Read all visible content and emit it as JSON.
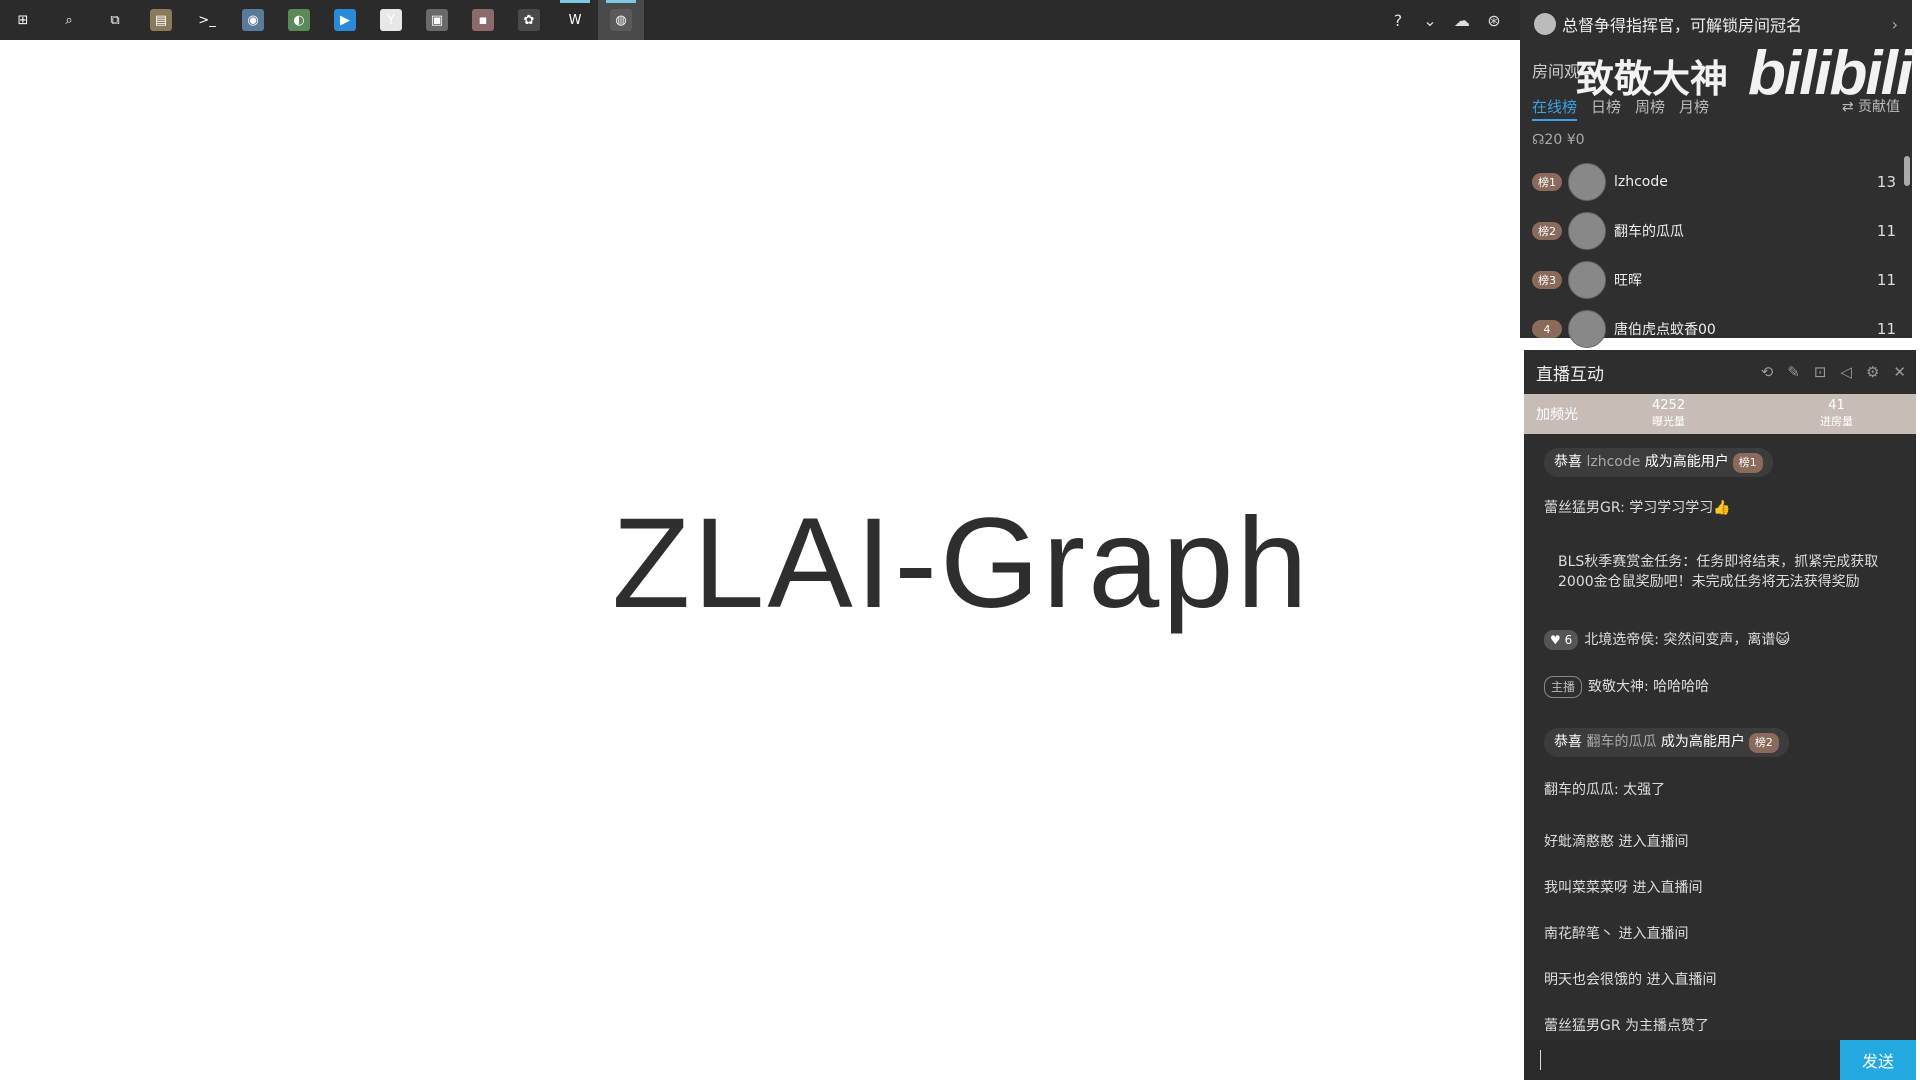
{
  "taskbar": {
    "icons": [
      {
        "name": "windows-start-icon",
        "glyph": "⊞",
        "color": "#2b2b2b"
      },
      {
        "name": "search-icon",
        "glyph": "⌕",
        "color": "#2b2b2b"
      },
      {
        "name": "task-view-icon",
        "glyph": "⧉",
        "color": "#2b2b2b"
      },
      {
        "name": "file-explorer-icon",
        "glyph": "▤",
        "color": "#8a7a5a"
      },
      {
        "name": "terminal-icon",
        "glyph": ">_",
        "color": "#2b2b2b"
      },
      {
        "name": "chrome-icon",
        "glyph": "◉",
        "color": "#5a7a9a"
      },
      {
        "name": "wechat-icon",
        "glyph": "◐",
        "color": "#5a8a5a"
      },
      {
        "name": "blue-app-icon",
        "glyph": "▶",
        "color": "#2a8ad8"
      },
      {
        "name": "white-app-icon",
        "glyph": "Y",
        "color": "#e8e8e8"
      },
      {
        "name": "editor-icon",
        "glyph": "▣",
        "color": "#6a6a6a"
      },
      {
        "name": "brown-app-icon",
        "glyph": "▪",
        "color": "#8a6a6a"
      },
      {
        "name": "game-app-icon",
        "glyph": "✿",
        "color": "#4a4a4a"
      },
      {
        "name": "wps-icon",
        "glyph": "W",
        "color": "#2b2b2b"
      },
      {
        "name": "live-app-icon",
        "glyph": "◍",
        "color": "#5a5a5a"
      }
    ],
    "tray": [
      {
        "name": "help-icon",
        "glyph": "?"
      },
      {
        "name": "chevron-down-icon",
        "glyph": "⌄"
      },
      {
        "name": "cloud-icon",
        "glyph": "☁"
      },
      {
        "name": "network-icon",
        "glyph": "⊛"
      }
    ]
  },
  "main": {
    "title": "ZLAI-Graph"
  },
  "rank_panel": {
    "banner": "总督争得指挥官，可解锁房间冠名",
    "banner_arrow": "›",
    "room_label": "房间观",
    "watermark": "致敬大神",
    "logo": "bilibili",
    "tabs": [
      "在线榜",
      "日榜",
      "周榜",
      "月榜"
    ],
    "active_tab": 0,
    "contribution_label": "⇄ 贡献值",
    "counts": "☊20  ¥0",
    "rows": [
      {
        "badge": "榜1",
        "name": "lzhcode",
        "score": "13"
      },
      {
        "badge": "榜2",
        "name": "翻车的瓜瓜",
        "score": "11"
      },
      {
        "badge": "榜3",
        "name": "旺晖",
        "score": "11"
      },
      {
        "badge": "4",
        "name": "唐伯虎点蚊香00",
        "score": "11"
      }
    ]
  },
  "chat_panel": {
    "title": "直播互动",
    "stats_label": "加频光",
    "stats": [
      {
        "value": "4252",
        "label": "曝光量"
      },
      {
        "value": "41",
        "label": "进房量"
      }
    ],
    "messages": [
      {
        "type": "pill",
        "prefix": "恭喜",
        "user": "lzhcode",
        "suffix": "成为高能用户",
        "badge": "榜1"
      },
      {
        "type": "plain",
        "text": "蕾丝猛男GR: 学习学习学习👍"
      },
      {
        "type": "plain",
        "text": "BLS秋季赛赏金任务：任务即将结束，抓紧完成获取2000金仓鼠奖励吧！未完成任务将无法获得奖励"
      },
      {
        "type": "fan",
        "tag": "♥ 6",
        "text": "北境选帝侯: 突然间变声，离谱😺"
      },
      {
        "type": "host",
        "tag": "主播",
        "text": "致敬大神: 哈哈哈哈"
      },
      {
        "type": "pill",
        "prefix": "恭喜",
        "user": "翻车的瓜瓜",
        "suffix": "成为高能用户",
        "badge": "榜2"
      },
      {
        "type": "plain",
        "text": "翻车的瓜瓜: 太强了"
      },
      {
        "type": "plain",
        "text": "好蚍滴憨憨 进入直播间"
      },
      {
        "type": "plain",
        "text": "我叫菜菜菜呀 进入直播间"
      },
      {
        "type": "plain",
        "text": "南花醉笔丶 进入直播间"
      },
      {
        "type": "plain",
        "text": "明天也会很饿的 进入直播间"
      },
      {
        "type": "plain",
        "text": "蕾丝猛男GR 为主播点赞了"
      }
    ],
    "send_label": "发送"
  }
}
